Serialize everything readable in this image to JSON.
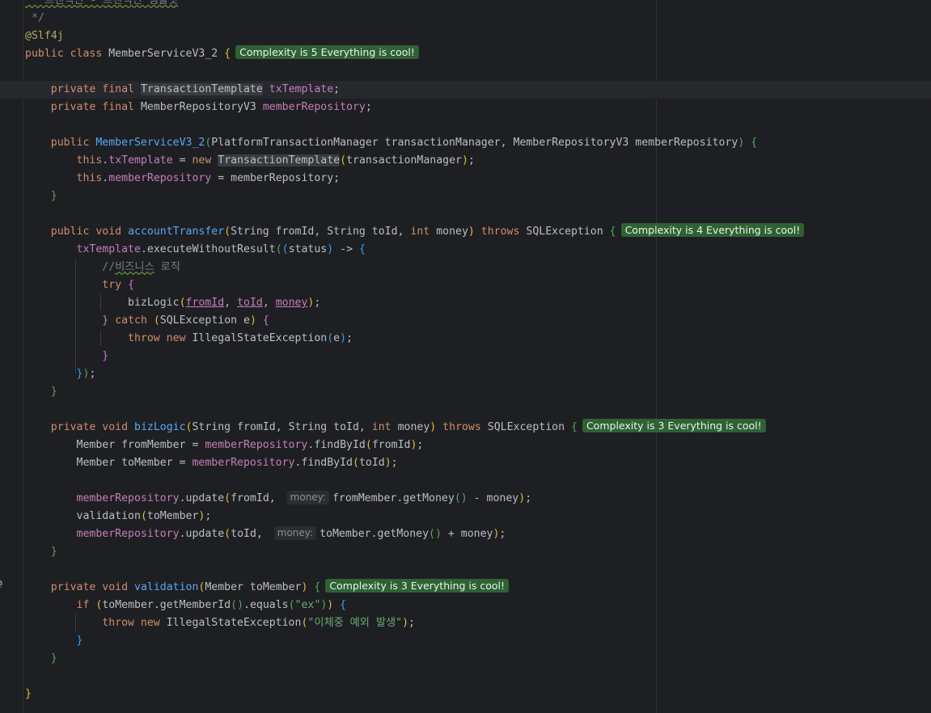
{
  "code": {
    "comment_top": " * 트랜잭션 - 트랜잭션 템플릿",
    "comment_end": " */",
    "annotation": "@Slf4j",
    "class_kw": "public class",
    "class_name": "MemberServiceV3_2",
    "field1_kw": "private final",
    "field1_type": "TransactionTemplate",
    "field1_name": "txTemplate",
    "field2_kw": "private final",
    "field2_type": "MemberRepositoryV3",
    "field2_name": "memberRepository",
    "ctor_kw": "public",
    "ctor_name": "MemberServiceV3_2",
    "ctor_params": "PlatformTransactionManager transactionManager, MemberRepositoryV3 memberRepository",
    "ctor_line1_this": "this",
    "ctor_line1_field": "txTemplate",
    "ctor_line1_new": "new",
    "ctor_line1_type": "TransactionTemplate",
    "ctor_line1_arg": "transactionManager",
    "ctor_line2_field": "memberRepository",
    "ctor_line2_rhs": "memberRepository",
    "m1_kw": "public void",
    "m1_name": "accountTransfer",
    "m1_params_a": "String fromId, String toId, ",
    "m1_params_int": "int",
    "m1_params_b": " money",
    "throws_kw": "throws",
    "exc": "SQLException",
    "tx_field": "txTemplate",
    "tx_call": "executeWithoutResult",
    "lambda_param": "status",
    "biz_comment_a": "//",
    "biz_comment_b": "비즈니스",
    "biz_comment_c": " 로직",
    "try_kw": "try",
    "biz_call": "bizLogic",
    "arg_from": "fromId",
    "arg_to": "toId",
    "arg_money": "money",
    "catch_kw": "catch",
    "catch_param": "SQLException e",
    "throw_kw": "throw new",
    "ise": "IllegalStateException",
    "e_var": "e",
    "m2_kw": "private void",
    "m2_name": "bizLogic",
    "m2_params_a": "String fromId, String toId, ",
    "m2_params_int": "int",
    "m2_params_b": " money",
    "m2_l1_a": "Member fromMember = ",
    "m2_l1_b": "findById",
    "m2_l1_c": "fromId",
    "m2_l2_a": "Member toMember = ",
    "m2_l2_c": "toId",
    "repo": "memberRepository",
    "update": "update",
    "m2_l3_arg": "fromId, ",
    "hint_money": "money:",
    "m2_l3_rest_a": "fromMember.getMoney",
    "m2_l3_rest_b": " - money",
    "m2_l4_a": "validation",
    "m2_l4_b": "toMember",
    "m2_l5_arg": "toId, ",
    "m2_l5_rest_a": "toMember.getMoney",
    "m2_l5_rest_b": " + money",
    "m3_kw": "private void",
    "m3_name": "validation",
    "m3_params": "Member toMember",
    "if_kw": "if",
    "if_a": "toMember.getMemberId",
    "if_b": ".equals",
    "if_str": "\"ex\"",
    "throw_str": "\"이체중 예외 발생\""
  },
  "badges": {
    "class": "Complexity is 5 Everything is cool!",
    "m1": "Complexity is 4 Everything is cool!",
    "m2": "Complexity is 3 Everything is cool!",
    "m3": "Complexity is 3 Everything is cool!"
  },
  "icons": {
    "gutter": "override-marker-icon"
  }
}
